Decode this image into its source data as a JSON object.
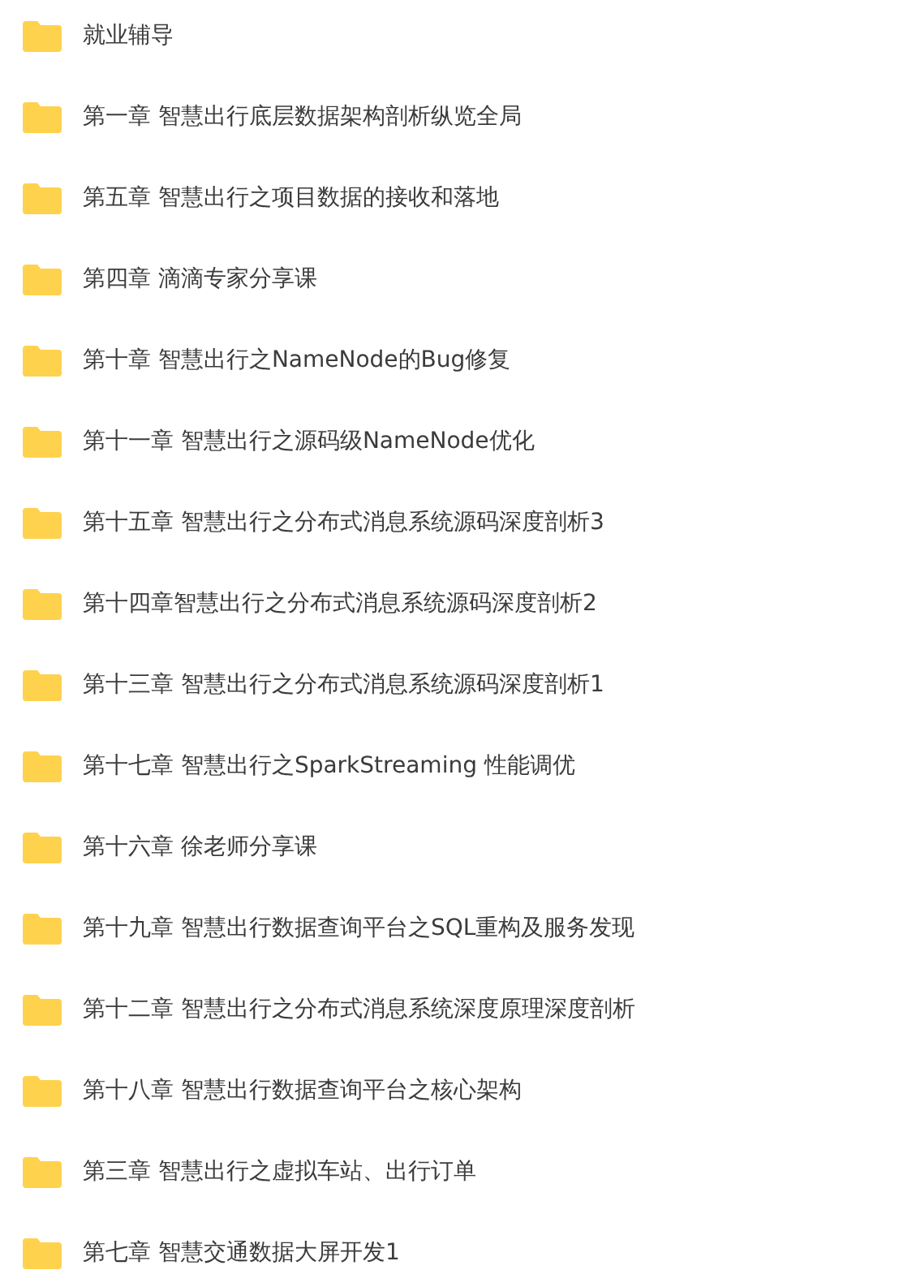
{
  "folders": [
    {
      "name": "就业辅导"
    },
    {
      "name": "第一章 智慧出行底层数据架构剖析纵览全局"
    },
    {
      "name": "第五章 智慧出行之项目数据的接收和落地"
    },
    {
      "name": "第四章 滴滴专家分享课"
    },
    {
      "name": "第十章 智慧出行之NameNode的Bug修复"
    },
    {
      "name": "第十一章 智慧出行之源码级NameNode优化"
    },
    {
      "name": "第十五章 智慧出行之分布式消息系统源码深度剖析3"
    },
    {
      "name": "第十四章智慧出行之分布式消息系统源码深度剖析2"
    },
    {
      "name": "第十三章 智慧出行之分布式消息系统源码深度剖析1"
    },
    {
      "name": "第十七章 智慧出行之SparkStreaming 性能调优"
    },
    {
      "name": "第十六章 徐老师分享课"
    },
    {
      "name": "第十九章 智慧出行数据查询平台之SQL重构及服务发现"
    },
    {
      "name": "第十二章 智慧出行之分布式消息系统深度原理深度剖析"
    },
    {
      "name": "第十八章 智慧出行数据查询平台之核心架构"
    },
    {
      "name": "第三章 智慧出行之虚拟车站、出行订单"
    },
    {
      "name": "第七章 智慧交通数据大屏开发1"
    }
  ]
}
